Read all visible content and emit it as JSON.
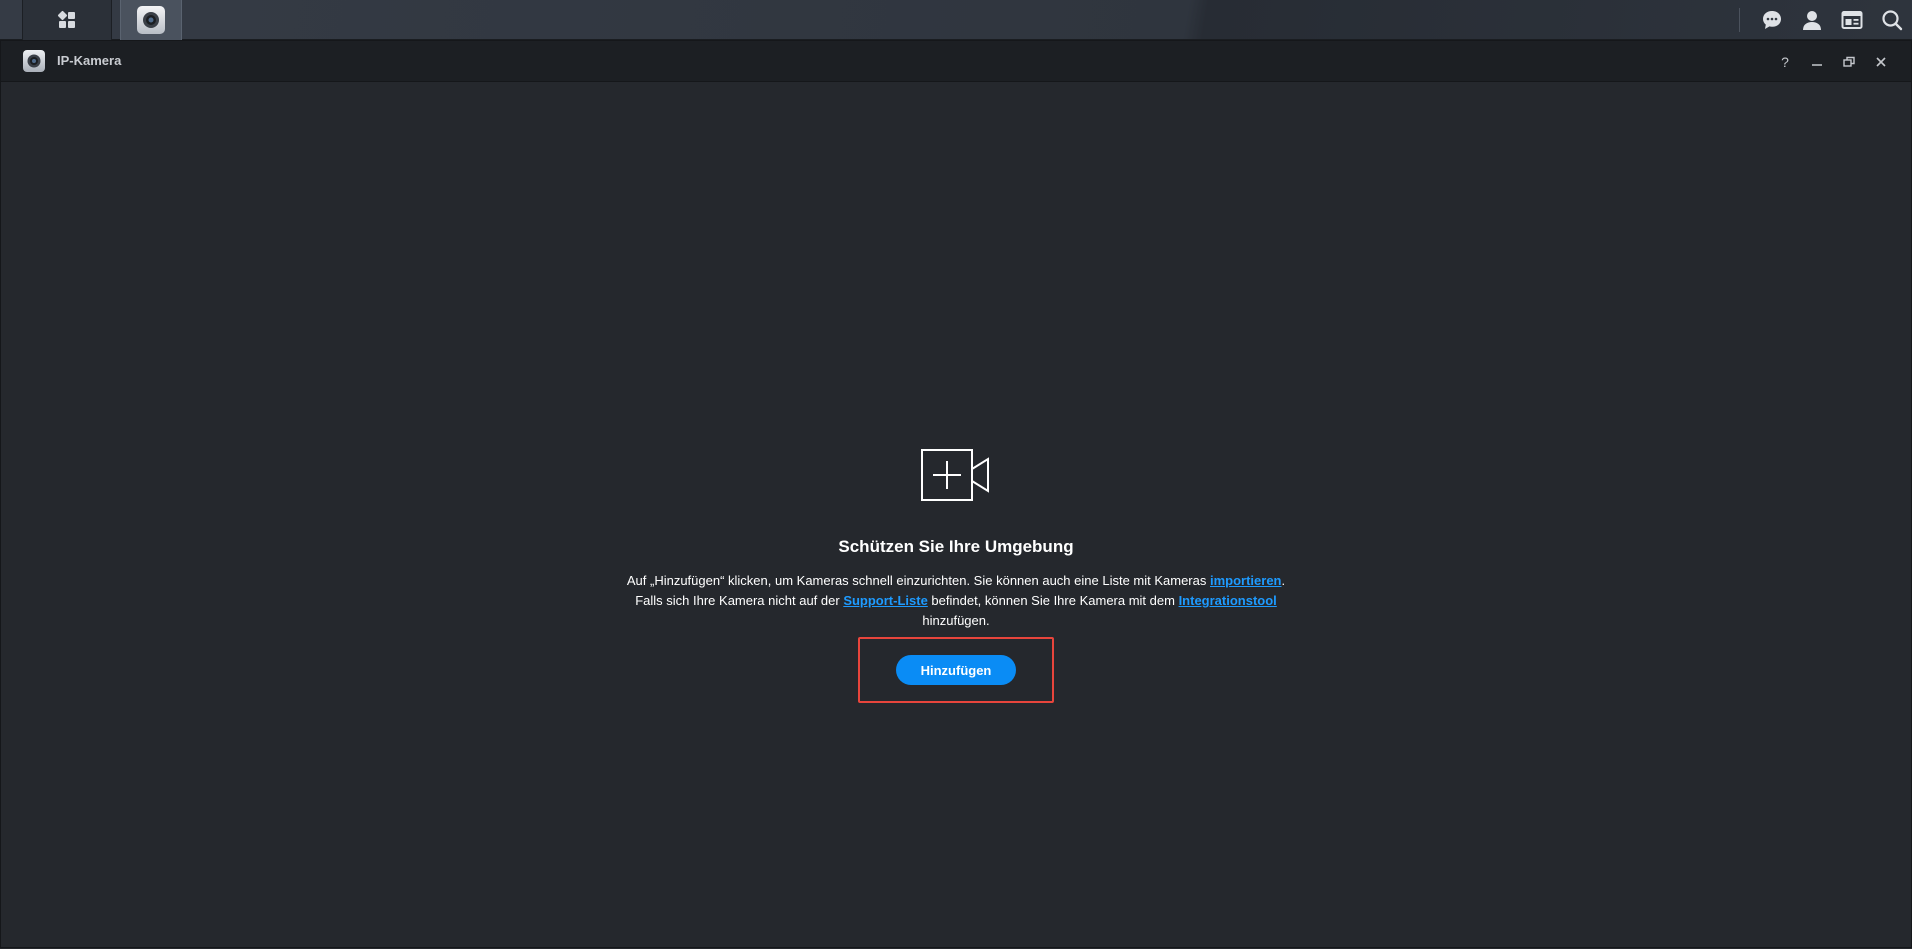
{
  "window": {
    "title": "IP-Kamera",
    "controls": {
      "help": "?",
      "minimize": "–",
      "restore": "⧉",
      "close": "✕"
    }
  },
  "taskbar": {
    "right_icons": [
      "chat-icon",
      "user-icon",
      "widgets-icon",
      "search-icon"
    ]
  },
  "main": {
    "icon": "add-camera-icon",
    "heading": "Schützen Sie Ihre Umgebung",
    "line1_pre": "Auf „Hinzufügen“ klicken, um Kameras schnell einzurichten. Sie können auch eine Liste mit Kameras ",
    "link_import": "importieren",
    "line1_post": ".",
    "line2_pre": "Falls sich Ihre Kamera nicht auf der ",
    "link_support": "Support-Liste",
    "line2_mid": " befindet, können Sie Ihre Kamera mit dem ",
    "link_integration": "Integrationstool",
    "line3": "hinzufügen.",
    "add_button": "Hinzufügen"
  },
  "colors": {
    "accent": "#0a8cf5",
    "link": "#1e9bff",
    "highlight_box": "#e8453c",
    "background": "#25282d"
  }
}
